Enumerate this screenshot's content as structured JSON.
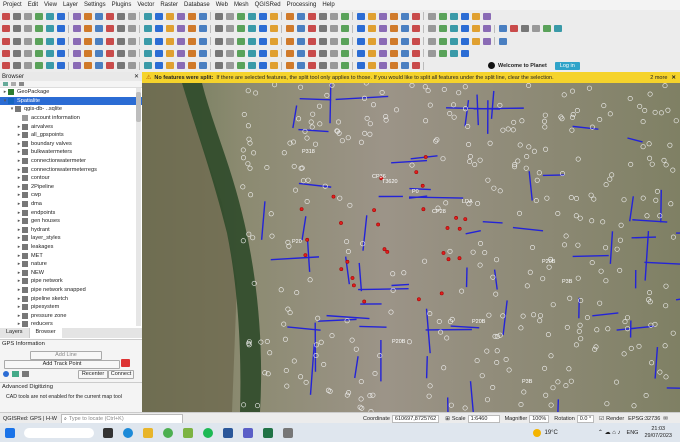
{
  "menu": [
    "Project",
    "Edit",
    "View",
    "Layer",
    "Settings",
    "Plugins",
    "Vector",
    "Raster",
    "Database",
    "Web",
    "Mesh",
    "QGISRed",
    "Processing",
    "Help"
  ],
  "toolbar": {
    "welcome_label": "Welcome to Planet",
    "login_label": "Log in"
  },
  "message_bar": {
    "bold": "No features were split:",
    "text": "If there are selected features, the split tool only applies to those. If you would like to split all features under the split line, clear the selection.",
    "more": "2 more"
  },
  "browser": {
    "title": "Browser",
    "items": [
      {
        "label": "GeoPackage",
        "depth": 0,
        "arrow": "▸",
        "icon": "#2e7d32"
      },
      {
        "label": "Spatialite",
        "depth": 0,
        "arrow": "▾",
        "icon": "#1565c0",
        "selected": true
      },
      {
        "label": "qgis-db-  ..sqlite",
        "depth": 1,
        "arrow": "▾",
        "icon": "#777"
      },
      {
        "label": "account information",
        "depth": 2,
        "arrow": "",
        "icon": "#999"
      },
      {
        "label": "airvalves",
        "depth": 2,
        "arrow": "▸",
        "icon": "#777"
      },
      {
        "label": "all_gpspoints",
        "depth": 2,
        "arrow": "▸",
        "icon": "#777"
      },
      {
        "label": "boundary valves",
        "depth": 2,
        "arrow": "▸",
        "icon": "#777"
      },
      {
        "label": "bulkwatermeters",
        "depth": 2,
        "arrow": "▸",
        "icon": "#777"
      },
      {
        "label": "connectionwatermeter",
        "depth": 2,
        "arrow": "▸",
        "icon": "#777"
      },
      {
        "label": "connectionwatermeterregs",
        "depth": 2,
        "arrow": "▸",
        "icon": "#777"
      },
      {
        "label": "contour",
        "depth": 2,
        "arrow": "▸",
        "icon": "#777"
      },
      {
        "label": "2Pipeline",
        "depth": 2,
        "arrow": "▸",
        "icon": "#777"
      },
      {
        "label": "cwp",
        "depth": 2,
        "arrow": "▸",
        "icon": "#777"
      },
      {
        "label": "dma",
        "depth": 2,
        "arrow": "▸",
        "icon": "#777"
      },
      {
        "label": "endpoints",
        "depth": 2,
        "arrow": "▸",
        "icon": "#777"
      },
      {
        "label": "gen houses",
        "depth": 2,
        "arrow": "▸",
        "icon": "#777"
      },
      {
        "label": "hydrant",
        "depth": 2,
        "arrow": "▸",
        "icon": "#777"
      },
      {
        "label": "layer_styles",
        "depth": 2,
        "arrow": "▸",
        "icon": "#777"
      },
      {
        "label": "leakages",
        "depth": 2,
        "arrow": "▸",
        "icon": "#777"
      },
      {
        "label": "MET",
        "depth": 2,
        "arrow": "▸",
        "icon": "#777"
      },
      {
        "label": "nature",
        "depth": 2,
        "arrow": "▸",
        "icon": "#777"
      },
      {
        "label": "NEW",
        "depth": 2,
        "arrow": "▸",
        "icon": "#777"
      },
      {
        "label": "pipe network",
        "depth": 2,
        "arrow": "▸",
        "icon": "#777"
      },
      {
        "label": "pipe network snapped",
        "depth": 2,
        "arrow": "▸",
        "icon": "#777"
      },
      {
        "label": "pipeline sketch",
        "depth": 2,
        "arrow": "▸",
        "icon": "#777"
      },
      {
        "label": "pipesystem",
        "depth": 2,
        "arrow": "▸",
        "icon": "#777"
      },
      {
        "label": "pressure zone",
        "depth": 2,
        "arrow": "▸",
        "icon": "#777"
      },
      {
        "label": "reducers",
        "depth": 2,
        "arrow": "▸",
        "icon": "#777"
      }
    ]
  },
  "tabs": [
    "Layers",
    "Browser"
  ],
  "gps": {
    "title": "GPS Information",
    "add_line": "Add Line",
    "add_track_point": "Add Track Point",
    "recenter": "Recenter",
    "connect": "Connect"
  },
  "digitizing": {
    "title": "Advanced Digitizing",
    "message": "CAD tools are not enabled for the current map tool"
  },
  "status": {
    "plugin": "QGISRed: GPS | H-W",
    "search_placeholder": "Type to locate (Ctrl+K)",
    "coordinate_label": "Coordinate",
    "coordinate": "610697,8725762",
    "scale_label": "Scale",
    "scale": "1:6460",
    "magnifier_label": "Magnifier",
    "magnifier": "100%",
    "rotation_label": "Rotation",
    "rotation": "0.0 °",
    "render_label": "Render",
    "crs": "EPSG:32736"
  },
  "taskbar": {
    "temperature": "19°C",
    "lang": "ENG",
    "time": "21:03",
    "date": "29/07/2023"
  },
  "map_labels": [
    "P318",
    "CP36",
    "CP28",
    "T3620",
    "P20",
    "P20B",
    "P0",
    "LDA",
    "P20B",
    "P20B",
    "P3B",
    "P3B"
  ],
  "colors": {
    "accent": "#f5d32b",
    "selection": "#2b6cd4",
    "pipes": "#2323d8",
    "points": "#e01e1e"
  }
}
